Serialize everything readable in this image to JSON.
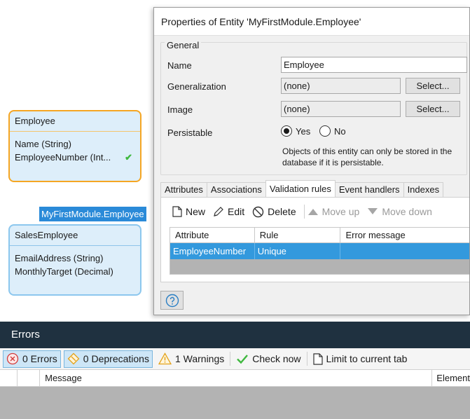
{
  "canvas": {
    "employee_entity": {
      "name": "Employee",
      "attributes": [
        "Name (String)",
        "EmployeeNumber (Int..."
      ]
    },
    "generalization_label": "MyFirstModule.Employee",
    "sales_entity": {
      "name": "SalesEmployee",
      "attributes": [
        "EmailAddress (String)",
        "MonthlyTarget (Decimal)"
      ]
    }
  },
  "dialog": {
    "title": "Properties of Entity 'MyFirstModule.Employee'",
    "general_legend": "General",
    "name_label": "Name",
    "name_value": "Employee",
    "generalization_label": "Generalization",
    "generalization_value": "(none)",
    "image_label": "Image",
    "image_value": "(none)",
    "select_label": "Select...",
    "persistable_label": "Persistable",
    "yes_label": "Yes",
    "no_label": "No",
    "persistable_selected": "Yes",
    "hint": "Objects of this entity can only be stored in the database if it is persistable.",
    "tabs": [
      "Attributes",
      "Associations",
      "Validation rules",
      "Event handlers",
      "Indexes"
    ],
    "active_tab": "Validation rules",
    "toolbar": {
      "new": "New",
      "edit": "Edit",
      "delete": "Delete",
      "move_up": "Move up",
      "move_down": "Move down"
    },
    "grid": {
      "columns": [
        "Attribute",
        "Rule",
        "Error message"
      ],
      "rows": [
        {
          "attribute": "EmployeeNumber",
          "rule": "Unique",
          "error_message": ""
        }
      ]
    }
  },
  "errors_pane": {
    "title": "Errors",
    "errors_btn": "0 Errors",
    "deprecations_btn": "0 Deprecations",
    "warnings_btn": "1 Warnings",
    "check_now": "Check now",
    "limit_tab": "Limit to current tab",
    "columns": [
      "Message",
      "Element"
    ]
  },
  "colors": {
    "entity_selected_border": "#f5a623",
    "entity_border": "#8cc7ee",
    "entity_fill": "#ddeefa",
    "selection_blue": "#3399dd",
    "errors_header_bg": "#1f3140"
  }
}
